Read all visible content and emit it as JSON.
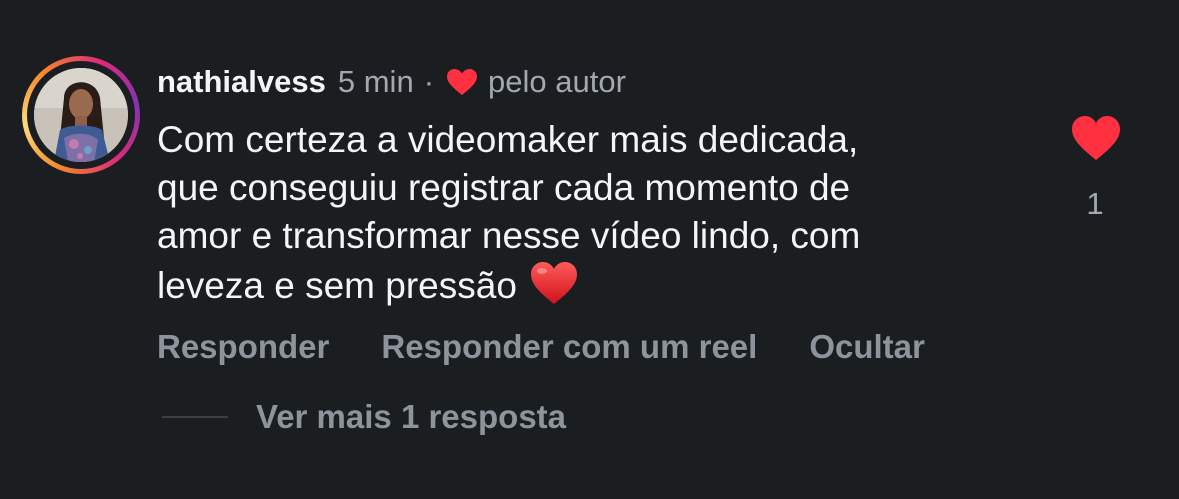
{
  "comment": {
    "username": "nathialvess",
    "time": "5 min",
    "separator": "·",
    "liked_by_author_label": "pelo autor",
    "text_lines": [
      "Com certeza a videomaker mais dedicada,",
      "que conseguiu registrar cada momento de",
      "amor e transformar nesse vídeo lindo, com",
      "leveza e sem pressão"
    ],
    "text_emoji": "red-heart-emoji",
    "like_count": "1"
  },
  "actions": {
    "reply": "Responder",
    "reply_with_reel": "Responder com um reel",
    "hide": "Ocultar"
  },
  "replies": {
    "label": "Ver mais 1 resposta"
  },
  "colors": {
    "background": "#1b1e21",
    "like_red": "#ff3040",
    "secondary_text": "#a3a8b0",
    "action_text": "#8e949c"
  },
  "icons": {
    "author_like": "heart-icon",
    "like_button": "heart-filled-icon"
  }
}
